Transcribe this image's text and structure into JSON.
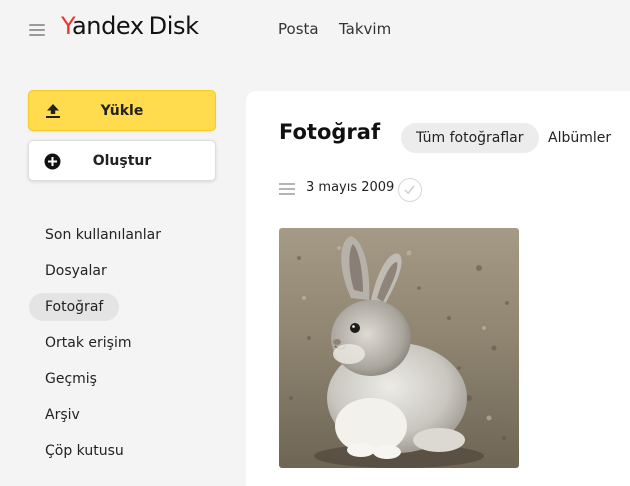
{
  "header": {
    "logo_y": "Y",
    "logo_rest": "andex",
    "logo_product": "Disk",
    "nav": [
      "Posta",
      "Takvim"
    ]
  },
  "sidebar": {
    "upload_label": "Yükle",
    "create_label": "Oluştur",
    "items": [
      {
        "label": "Son kullanılanlar",
        "active": false
      },
      {
        "label": "Dosyalar",
        "active": false
      },
      {
        "label": "Fotoğraf",
        "active": true
      },
      {
        "label": "Ortak erişim",
        "active": false
      },
      {
        "label": "Geçmiş",
        "active": false
      },
      {
        "label": "Arşiv",
        "active": false
      },
      {
        "label": "Çöp kutusu",
        "active": false
      }
    ]
  },
  "main": {
    "title": "Fotoğraf",
    "tabs": [
      {
        "label": "Tüm fotoğraflar",
        "active": true
      },
      {
        "label": "Albümler",
        "active": false
      }
    ],
    "group_date": "3 mayıs 2009",
    "photos": [
      {
        "subject": "snowshoe-hare"
      }
    ]
  },
  "colors": {
    "accent_yellow": "#ffdb4d",
    "logo_red": "#f0332b",
    "background": "#f4f4f4",
    "panel": "#ffffff"
  },
  "icons": {
    "menu": "hamburger-icon",
    "upload": "upload-arrow-icon",
    "create": "plus-circle-icon",
    "list": "list-view-icon",
    "select": "check-circle-icon"
  }
}
